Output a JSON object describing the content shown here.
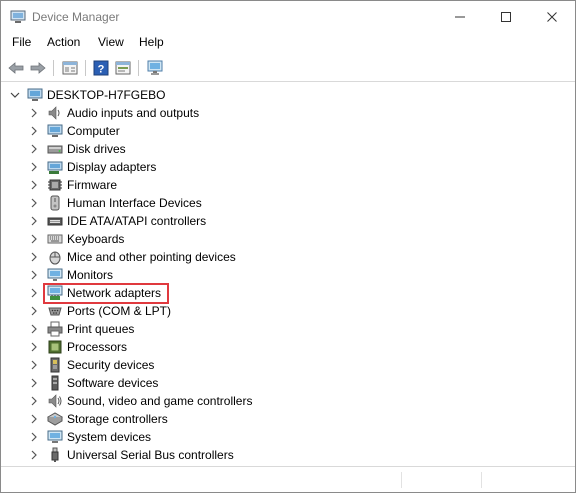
{
  "window": {
    "title": "Device Manager"
  },
  "menu": [
    {
      "label": "File"
    },
    {
      "label": "Action"
    },
    {
      "label": "View"
    },
    {
      "label": "Help"
    }
  ],
  "toolbar": {
    "buttons": [
      "back-arrow-icon",
      "forward-arrow-icon",
      "properties-icon",
      "help-icon",
      "update-driver-icon",
      "scan-hardware-icon"
    ]
  },
  "tree": {
    "root": {
      "label": "DESKTOP-H7FGEBO",
      "icon": "computer-icon",
      "expanded": true
    },
    "items": [
      {
        "label": "Audio inputs and outputs",
        "icon": "speaker-icon"
      },
      {
        "label": "Computer",
        "icon": "computer-monitor-icon"
      },
      {
        "label": "Disk drives",
        "icon": "disk-drive-icon"
      },
      {
        "label": "Display adapters",
        "icon": "display-adapter-icon"
      },
      {
        "label": "Firmware",
        "icon": "firmware-chip-icon"
      },
      {
        "label": "Human Interface Devices",
        "icon": "hid-icon"
      },
      {
        "label": "IDE ATA/ATAPI controllers",
        "icon": "ide-controller-icon"
      },
      {
        "label": "Keyboards",
        "icon": "keyboard-icon"
      },
      {
        "label": "Mice and other pointing devices",
        "icon": "mouse-icon"
      },
      {
        "label": "Monitors",
        "icon": "monitor-icon"
      },
      {
        "label": "Network adapters",
        "icon": "network-adapter-icon",
        "highlighted": true
      },
      {
        "label": "Ports (COM & LPT)",
        "icon": "port-icon"
      },
      {
        "label": "Print queues",
        "icon": "printer-icon"
      },
      {
        "label": "Processors",
        "icon": "processor-icon"
      },
      {
        "label": "Security devices",
        "icon": "security-device-icon"
      },
      {
        "label": "Software devices",
        "icon": "software-device-icon"
      },
      {
        "label": "Sound, video and game controllers",
        "icon": "sound-icon"
      },
      {
        "label": "Storage controllers",
        "icon": "storage-controller-icon"
      },
      {
        "label": "System devices",
        "icon": "system-device-icon"
      },
      {
        "label": "Universal Serial Bus controllers",
        "icon": "usb-icon"
      }
    ]
  },
  "colors": {
    "highlight": "#e0393e",
    "title_text": "#7a7a7a"
  }
}
